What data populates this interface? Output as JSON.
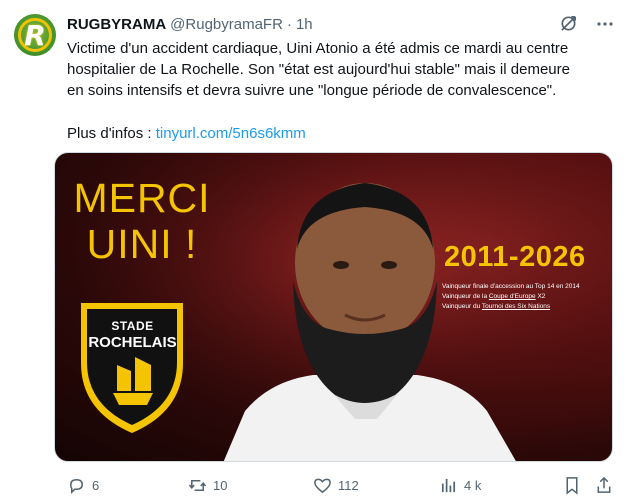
{
  "tweet": {
    "author_name": "RUGBYRAMA",
    "handle": "@RugbyramaFR",
    "separator": "·",
    "time": "1h",
    "lines": [
      "Victime d'un accident cardiaque, Uini Atonio a été admis ce mardi au centre",
      "hospitalier de La Rochelle. Son \"état est aujourd'hui stable\" mais il demeure",
      "en soins intensifs et devra suivre une \"longue période de convalescence\"."
    ],
    "more_label": "Plus d'infos : ",
    "link": "tinyurl.com/5n6s6kmm"
  },
  "media": {
    "merci_line1": "MERCI",
    "merci_line2": "UINI !",
    "years": "2011-2026",
    "honors": {
      "line1": "Vainqueur finale d'accession au Top 14 en 2014",
      "line2_prefix": "Vainqueur de la ",
      "line2_link": "Coupe d'Europe",
      "line2_suffix": " X2",
      "line3_prefix": "Vainqueur du ",
      "line3_link": "Tournoi des Six Nations"
    },
    "badge_line1": "STADE",
    "badge_line2": "ROCHELAIS"
  },
  "actions": {
    "replies": "6",
    "reposts": "10",
    "likes": "112",
    "views": "4 k"
  },
  "icons": {
    "avatar_letter": "R",
    "top_right": [
      "grok-icon",
      "more-icon"
    ],
    "bottom": [
      "reply-icon",
      "repost-icon",
      "like-icon",
      "views-icon",
      "bookmark-icon",
      "share-icon"
    ]
  },
  "colors": {
    "accent": "#1d9bf0",
    "secondary_text": "#536471",
    "primary_text": "#0f1419",
    "yellow": "#f5c400"
  }
}
